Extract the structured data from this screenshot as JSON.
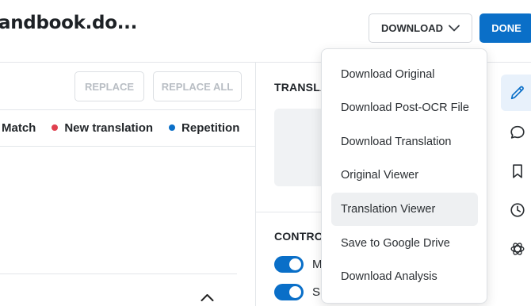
{
  "header": {
    "document_title": "andbook.do...",
    "download_label": "DOWNLOAD",
    "done_label": "DONE"
  },
  "search_replace": {
    "replace_label": "REPLACE",
    "replace_all_label": "REPLACE ALL"
  },
  "legend": [
    {
      "label": "Match",
      "color": ""
    },
    {
      "label": "New translation",
      "color": "#e0404f"
    },
    {
      "label": "Repetition",
      "color": "#0a6fc8"
    }
  ],
  "translation_panel": {
    "title": "TRANSLA"
  },
  "controls_panel": {
    "title": "CONTRO",
    "toggles": [
      {
        "label": "M",
        "on": true
      },
      {
        "label": "S",
        "on": true
      }
    ]
  },
  "download_menu": {
    "items": [
      {
        "label": "Download Original"
      },
      {
        "label": "Download Post-OCR File"
      },
      {
        "label": "Download Translation"
      },
      {
        "label": "Original Viewer"
      },
      {
        "label": "Translation Viewer"
      },
      {
        "label": "Save to Google Drive"
      },
      {
        "label": "Download Analysis"
      }
    ],
    "highlighted_index": 4
  },
  "right_rail": {
    "icons": [
      "pencil-icon",
      "comment-icon",
      "bookmark-icon",
      "history-icon",
      "openai-icon"
    ],
    "active_index": 0
  },
  "colors": {
    "accent": "#0a6fc8",
    "new_translation": "#e0404f",
    "repetition": "#0a6fc8"
  }
}
